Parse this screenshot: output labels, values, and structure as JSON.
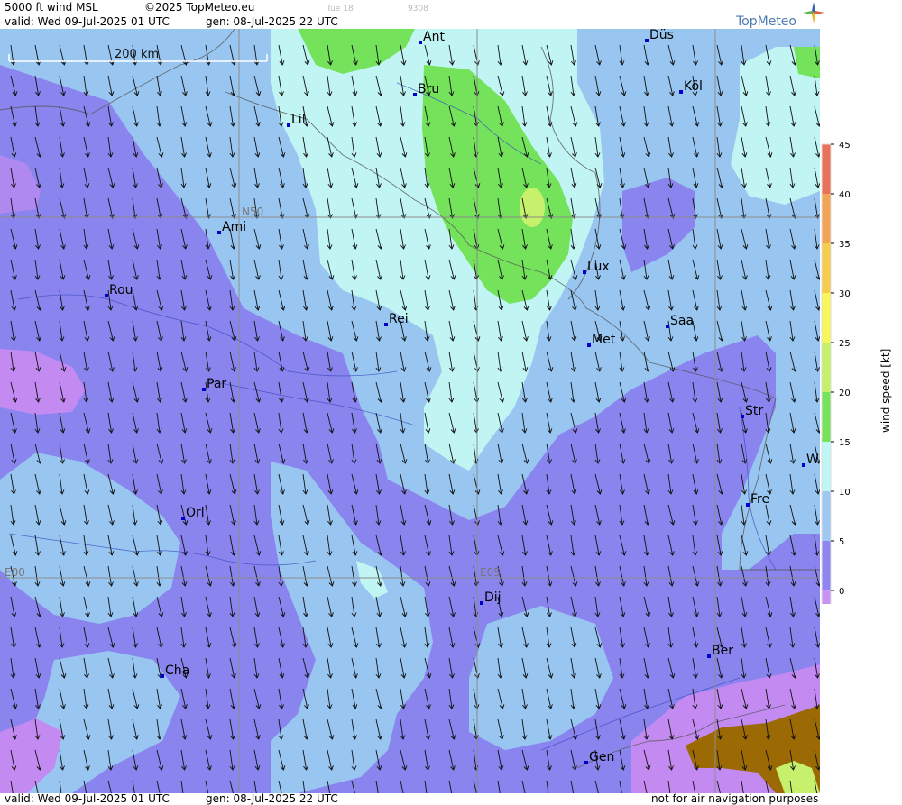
{
  "header": {
    "product": "5000 ft wind MSL",
    "copyright": "©2025 TopMeteo.eu",
    "run_hint": "Tue 18",
    "code_hint": "9308",
    "valid": "valid:  Wed  09-Jul-2025  01 UTC",
    "generated": "gen: 08-Jul-2025 22 UTC",
    "logo": "TopMeteo"
  },
  "scale_bar": {
    "label": "200 km"
  },
  "grid_labels": {
    "lat": "N50",
    "lon1": "E00",
    "lon2": "E05"
  },
  "cities": [
    {
      "name": "Ant"
    },
    {
      "name": "Düs"
    },
    {
      "name": "Bru"
    },
    {
      "name": "Köl"
    },
    {
      "name": "Lil"
    },
    {
      "name": "Ami"
    },
    {
      "name": "Lux"
    },
    {
      "name": "Rou"
    },
    {
      "name": "Rei"
    },
    {
      "name": "Saa"
    },
    {
      "name": "Met"
    },
    {
      "name": "Par"
    },
    {
      "name": "Str"
    },
    {
      "name": "W"
    },
    {
      "name": "Fre"
    },
    {
      "name": "Orl"
    },
    {
      "name": "Dij"
    },
    {
      "name": "Ber"
    },
    {
      "name": "Cha"
    },
    {
      "name": "Gen"
    }
  ],
  "legend": {
    "title": "wind  speed  [kt]",
    "ticks": [
      "45",
      "40",
      "35",
      "30",
      "25",
      "20",
      "15",
      "10",
      "5",
      "0"
    ],
    "colors": [
      "#e8735a",
      "#f2a456",
      "#f5cc4e",
      "#f7f75a",
      "#c6f06a",
      "#77e25c",
      "#bff6f4",
      "#9ec7f2",
      "#8e85f0",
      "#c993f4"
    ]
  },
  "footer": {
    "valid": "valid:  Wed  09-Jul-2025  01 UTC",
    "generated": "gen: 08-Jul-2025 22 UTC",
    "disclaimer": "not for air navigation purposes"
  },
  "colors": {
    "calm": "#c38bf2",
    "light": "#8a84ee",
    "moderate": "#98c6f1",
    "fresh": "#c0f5f4",
    "strong": "#74e25a",
    "strong2": "#c7f16c",
    "terrain": "#9b6a05",
    "grid": "#8c8c8c",
    "city": "#0000cc"
  }
}
